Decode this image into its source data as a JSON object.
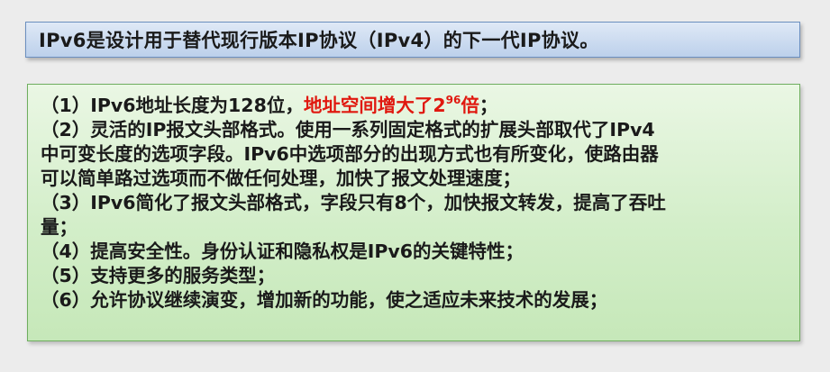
{
  "title": "IPv6是设计用于替代现行版本IP协议（IPv4）的下一代IP协议。",
  "items": {
    "l1_prefix": "（1）IPv6地址长度为128位，",
    "l1_highlight": "地址空间增大了2",
    "l1_exponent": "96",
    "l1_highlight_end": "倍",
    "l1_suffix": "；",
    "l2": "（2）灵活的IP报文头部格式。使用一系列固定格式的扩展头部取代了IPv4",
    "l3": "中可变长度的选项字段。IPv6中选项部分的出现方式也有所变化，使路由器",
    "l4": "可以简单路过选项而不做任何处理，加快了报文处理速度；",
    "l5": "（3）IPv6简化了报文头部格式，字段只有8个，加快报文转发，提高了吞吐",
    "l6": "量；",
    "l7": "（4）提高安全性。身份认证和隐私权是IPv6的关键特性；",
    "l8": "（5）支持更多的服务类型；",
    "l9": "（6）允许协议继续演变，增加新的功能，使之适应未来技术的发展；"
  },
  "colors": {
    "highlight": "#e0180f",
    "title_border": "#6b8fbf",
    "content_border": "#6fae5f"
  }
}
